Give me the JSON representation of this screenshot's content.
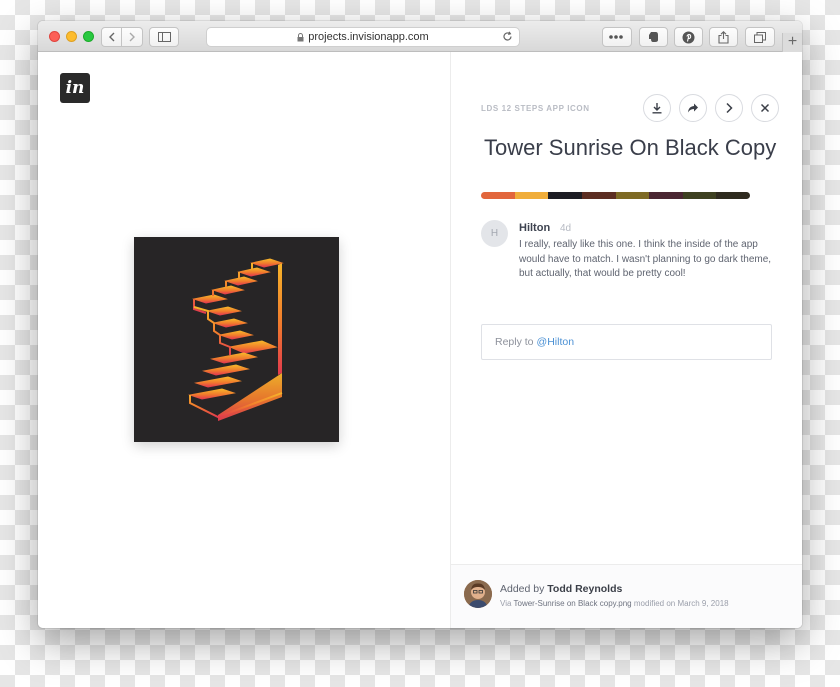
{
  "browser": {
    "url": "projects.invisionapp.com",
    "new_tab": "+"
  },
  "app": {
    "logo_text": "in"
  },
  "screen": {
    "breadcrumb": "LDS 12 STEPS APP ICON",
    "title": "Tower Sunrise On Black Copy",
    "palette": [
      "#e2663c",
      "#f0ad3a",
      "#1d1d24",
      "#5c2e22",
      "#7e6a24",
      "#4a2632",
      "#3d4020",
      "#2e2a1e"
    ]
  },
  "comment": {
    "avatar_initial": "H",
    "author": "Hilton",
    "time": "4d",
    "text": "I really, really like this one. I think the inside of the app would have to match. I wasn't planning to go dark theme, but actually, that would be pretty cool!"
  },
  "reply": {
    "prefix": "Reply to",
    "mention": "@Hilton"
  },
  "footer": {
    "added_prefix": "Added by",
    "author": "Todd Reynolds",
    "via_prefix": "Via",
    "file": "Tower-Sunrise on Black copy.png",
    "modified": "modified on March 9, 2018"
  }
}
